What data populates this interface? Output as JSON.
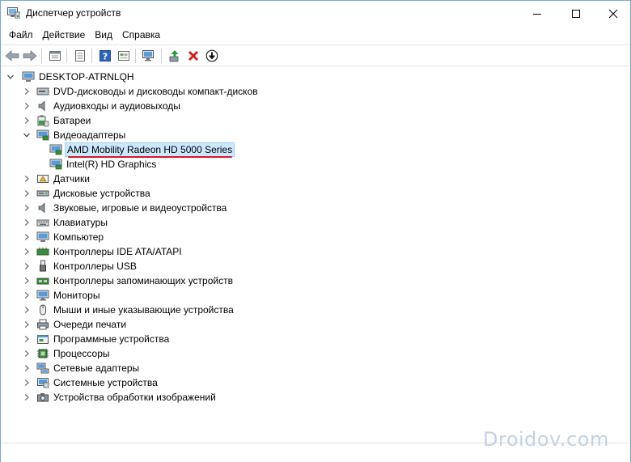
{
  "window": {
    "title": "Диспетчер устройств"
  },
  "menu": [
    {
      "label": "Файл"
    },
    {
      "label": "Действие"
    },
    {
      "label": "Вид"
    },
    {
      "label": "Справка"
    }
  ],
  "toolbar": {
    "buttons": [
      "back-arrow-icon",
      "forward-arrow-icon",
      "properties-icon",
      "view-icon",
      "help-icon",
      "show-hidden-icon",
      "monitor-scan-icon",
      "update-driver-icon",
      "delete-icon",
      "download-icon"
    ]
  },
  "tree": {
    "root": "DESKTOP-ATRNLQH",
    "categories": [
      {
        "label": "DVD-дисководы и дисководы компакт-дисков",
        "icon": "dvd-icon"
      },
      {
        "label": "Аудиовходы и аудиовыходы",
        "icon": "speaker-icon"
      },
      {
        "label": "Батареи",
        "icon": "battery-icon"
      },
      {
        "label": "Видеоадаптеры",
        "icon": "display-adapter-icon",
        "expanded": true,
        "children": [
          {
            "label": "AMD Mobility Radeon HD 5000 Series",
            "selected": true
          },
          {
            "label": "Intel(R) HD Graphics"
          }
        ]
      },
      {
        "label": "Датчики",
        "icon": "sensor-icon"
      },
      {
        "label": "Дисковые устройства",
        "icon": "disk-icon"
      },
      {
        "label": "Звуковые, игровые и видеоустройства",
        "icon": "speaker-icon"
      },
      {
        "label": "Клавиатуры",
        "icon": "keyboard-icon"
      },
      {
        "label": "Компьютер",
        "icon": "computer-icon"
      },
      {
        "label": "Контроллеры IDE ATA/ATAPI",
        "icon": "ide-controller-icon"
      },
      {
        "label": "Контроллеры USB",
        "icon": "usb-icon"
      },
      {
        "label": "Контроллеры запоминающих устройств",
        "icon": "storage-controller-icon"
      },
      {
        "label": "Мониторы",
        "icon": "monitor-icon"
      },
      {
        "label": "Мыши и иные указывающие устройства",
        "icon": "mouse-icon"
      },
      {
        "label": "Очереди печати",
        "icon": "printer-icon"
      },
      {
        "label": "Программные устройства",
        "icon": "software-device-icon"
      },
      {
        "label": "Процессоры",
        "icon": "processor-icon"
      },
      {
        "label": "Сетевые адаптеры",
        "icon": "network-adapter-icon"
      },
      {
        "label": "Системные устройства",
        "icon": "system-device-icon"
      },
      {
        "label": "Устройства обработки изображений",
        "icon": "camera-icon"
      }
    ]
  },
  "watermark": "Droidov.com",
  "colors": {
    "selection": "#cce8ff",
    "selection_border": "#99d1ff",
    "underline": "#d11a2a",
    "accent": "#1e78c8"
  }
}
